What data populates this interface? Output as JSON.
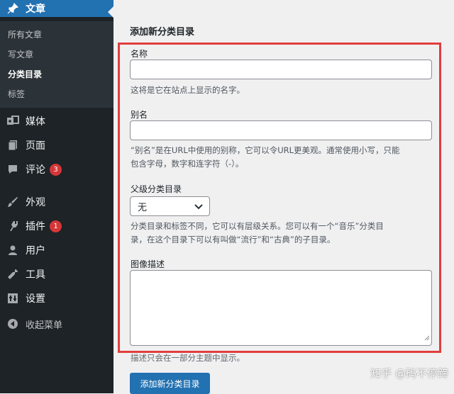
{
  "sidebar": {
    "posts": {
      "label": "文章",
      "icon": "pin-icon"
    },
    "submenu": [
      {
        "label": "所有文章"
      },
      {
        "label": "写文章"
      },
      {
        "label": "分类目录"
      },
      {
        "label": "标签"
      }
    ],
    "items": [
      {
        "label": "媒体",
        "icon": "media-icon"
      },
      {
        "label": "页面",
        "icon": "page-icon"
      },
      {
        "label": "评论",
        "icon": "comment-icon",
        "badge": "3"
      },
      {
        "label": "外观",
        "icon": "brush-icon"
      },
      {
        "label": "插件",
        "icon": "plugin-icon",
        "badge": "1"
      },
      {
        "label": "用户",
        "icon": "user-icon"
      },
      {
        "label": "工具",
        "icon": "wrench-icon"
      },
      {
        "label": "设置",
        "icon": "settings-icon"
      },
      {
        "label": "收起菜单",
        "icon": "collapse-icon"
      }
    ],
    "colors": {
      "bg": "#1d2327",
      "submenu_bg": "#2c3338",
      "current": "#2271b1",
      "badge": "#d63638"
    }
  },
  "form": {
    "title": "添加新分类目录",
    "name_label": "名称",
    "name_value": "",
    "name_help": "这将是它在站点上显示的名字。",
    "slug_label": "别名",
    "slug_value": "",
    "slug_help_1": "“别名”是在URL中使用的别称，它可以令URL更美观。通常使用小写，只能",
    "slug_help_2": "包含字母，数字和连字符（-）。",
    "parent_label": "父级分类目录",
    "parent_selected": "无",
    "parent_help_1": "分类目录和标签不同，它可以有层级关系。您可以有一个“音乐”分类目",
    "parent_help_2": "录，在这个目录下可以有叫做“流行”和“古典”的子目录。",
    "image_label": "图像描述",
    "image_value": "",
    "image_help": "描述只会在一部分主题中显示。",
    "submit_label": "添加新分类目录",
    "highlight_color": "#e23d3d"
  },
  "watermark": "知乎 @码不停蹄"
}
